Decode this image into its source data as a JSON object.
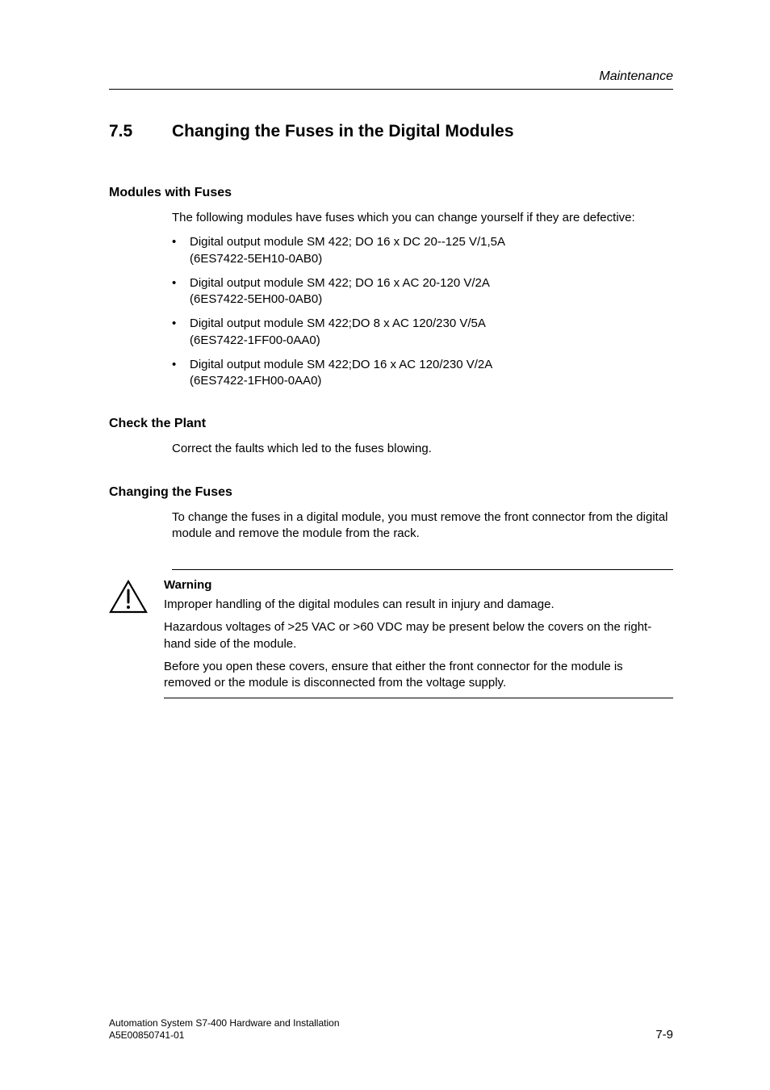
{
  "running_header": "Maintenance",
  "section": {
    "number": "7.5",
    "title": "Changing the Fuses in the Digital Modules"
  },
  "modules_with_fuses": {
    "heading": "Modules with Fuses",
    "intro": "The following modules have fuses which you can change yourself if they are defective:",
    "items": [
      {
        "line1": "Digital output module SM 422; DO 16 x DC 20--125 V/1,5A",
        "line2": "(6ES7422-5EH10-0AB0)"
      },
      {
        "line1": "Digital output module SM 422; DO 16 x AC 20-120 V/2A",
        "line2": "(6ES7422-5EH00-0AB0)"
      },
      {
        "line1": "Digital output module SM 422;DO 8 x AC 120/230 V/5A",
        "line2": "(6ES7422-1FF00-0AA0)"
      },
      {
        "line1": "Digital output module SM 422;DO 16 x AC 120/230 V/2A",
        "line2": "(6ES7422-1FH00-0AA0)"
      }
    ]
  },
  "check_plant": {
    "heading": "Check the Plant",
    "text": "Correct the faults which led to the fuses blowing."
  },
  "changing_fuses": {
    "heading": "Changing the Fuses",
    "text": "To change the fuses in a digital module, you must remove the front connector from the digital module and remove the module from the rack."
  },
  "warning": {
    "label": "Warning",
    "p1": "Improper handling of the digital modules can result in injury and damage.",
    "p2": "Hazardous voltages of >25 VAC or >60 VDC may be present below the covers on the right-hand side of the module.",
    "p3": "Before you open these covers, ensure that either the front connector for the module is removed or the module is disconnected from the voltage supply."
  },
  "footer": {
    "left_line1": "Automation System S7-400  Hardware and Installation",
    "left_line2": "A5E00850741-01",
    "page_number": "7-9"
  }
}
